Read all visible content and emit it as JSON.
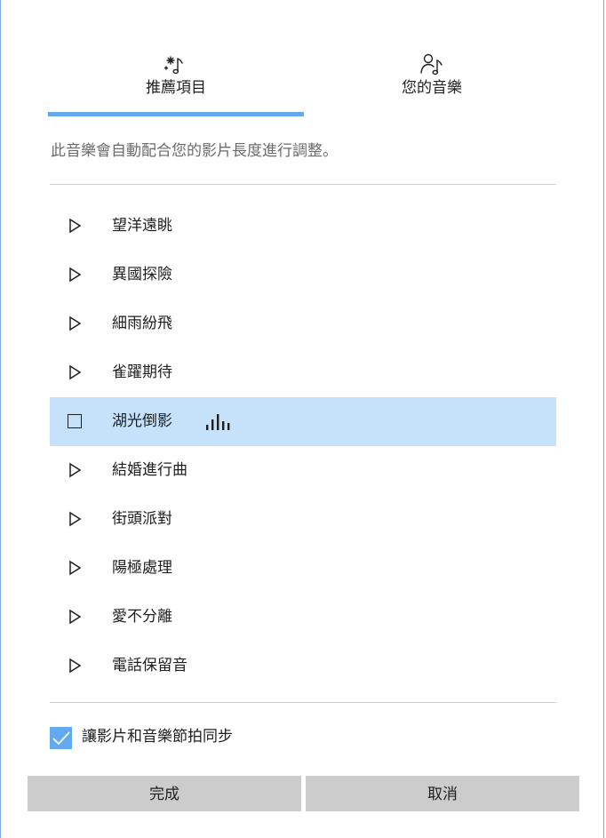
{
  "tabs": [
    {
      "label": "推薦項目",
      "icon": "sparkle-music-icon",
      "active": true
    },
    {
      "label": "您的音樂",
      "icon": "person-music-icon",
      "active": false
    }
  ],
  "description": "此音樂會自動配合您的影片長度進行調整。",
  "tracks": [
    {
      "name": "望洋遠眺",
      "state": "play"
    },
    {
      "name": "異國探險",
      "state": "play"
    },
    {
      "name": "細雨紛飛",
      "state": "play"
    },
    {
      "name": "雀躍期待",
      "state": "play"
    },
    {
      "name": "湖光倒影",
      "state": "playing"
    },
    {
      "name": "結婚進行曲",
      "state": "play"
    },
    {
      "name": "街頭派對",
      "state": "play"
    },
    {
      "name": "陽極處理",
      "state": "play"
    },
    {
      "name": "愛不分離",
      "state": "play"
    },
    {
      "name": "電話保留音",
      "state": "play"
    }
  ],
  "sync": {
    "label": "讓影片和音樂節拍同步",
    "checked": true
  },
  "buttons": {
    "done": "完成",
    "cancel": "取消"
  },
  "colors": {
    "accent": "#63a9ee",
    "selected_row": "#c6e1fa",
    "button_bg": "#cccccc"
  }
}
